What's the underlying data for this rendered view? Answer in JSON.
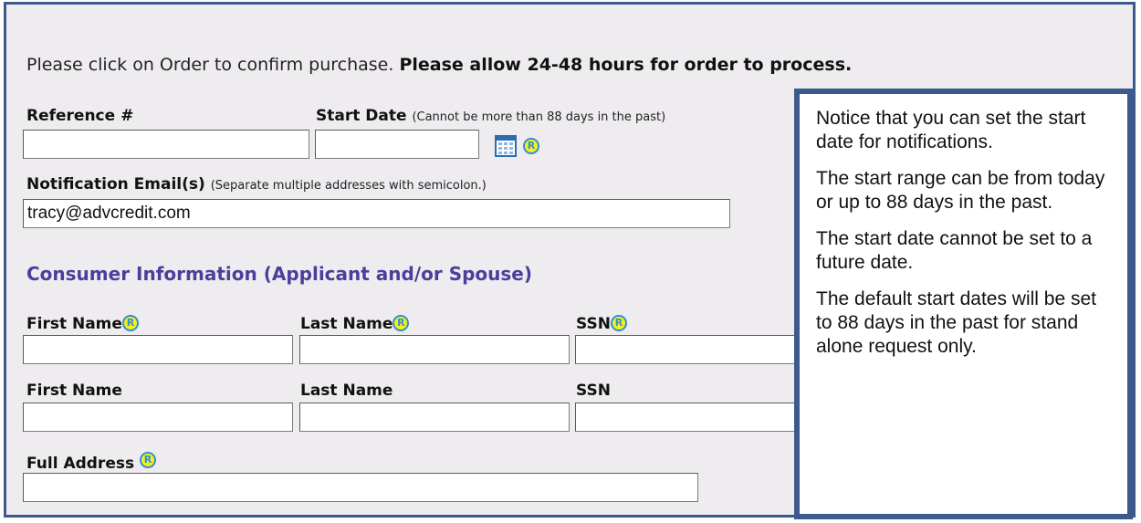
{
  "intro": {
    "text": "Please click on Order to confirm purchase. ",
    "bold_text": "Please allow 24-48 hours for order to process."
  },
  "form": {
    "reference": {
      "label": "Reference #",
      "value": ""
    },
    "start_date": {
      "label": "Start Date",
      "hint": "(Cannot be more than 88 days in the past)",
      "value": ""
    },
    "notification_email": {
      "label": "Notification Email(s)",
      "hint": "(Separate multiple addresses with semicolon.)",
      "value": "tracy@advcredit.com"
    },
    "section_title": "Consumer Information (Applicant and/or Spouse)",
    "applicant": {
      "first_name_label": "First Name",
      "last_name_label": "Last Name",
      "ssn_label": "SSN"
    },
    "spouse": {
      "first_name_label": "First Name",
      "last_name_label": "Last Name",
      "ssn_label": "SSN"
    },
    "full_address": {
      "label": "Full Address",
      "value": ""
    },
    "required_icon_letter": "R"
  },
  "callout": {
    "paragraphs": [
      "Notice that you can set the start date for notifications.",
      "The start range can be from today or up to 88 days in the past.",
      "The start date cannot be set to a future date.",
      "The default start dates will be set to 88 days in the past for stand alone request only."
    ]
  },
  "colors": {
    "frame_border": "#3d5a8c",
    "panel_bg": "#efecf0",
    "section_title": "#4a3f9a",
    "required_icon_fill": "#f7f01a",
    "required_icon_ring": "#2e8fd8"
  },
  "icons": {
    "calendar": "calendar-icon",
    "required": "required-icon"
  }
}
